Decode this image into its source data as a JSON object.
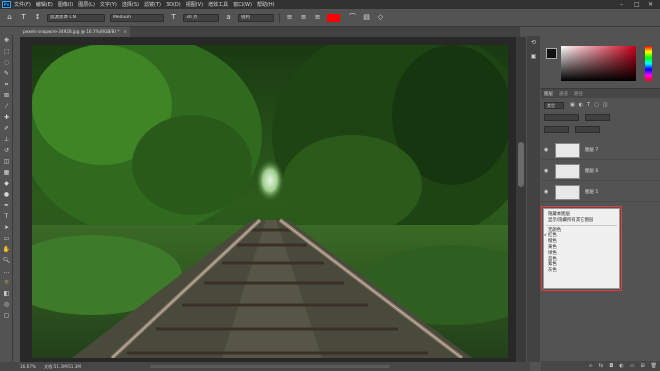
{
  "menubar": {
    "items": [
      "文件(F)",
      "编辑(E)",
      "图像(I)",
      "图层(L)",
      "文字(Y)",
      "选择(S)",
      "滤镜(T)",
      "3D(D)",
      "视图(V)",
      "增效工具",
      "窗口(W)",
      "帮助(H)"
    ],
    "logo": "Ps"
  },
  "options": {
    "font_family": "思源黑体 CN",
    "font_style": "Medium",
    "font_size": "30 点",
    "antialias": "锐利"
  },
  "document": {
    "tab_title": "pexels-snapwire-34928.jpg @ 16.7%(RGB/8) *",
    "zoom": "16.67%",
    "doc_info": "文档:51.3M/51.3M"
  },
  "layers": {
    "tab_label": "图层",
    "tab_channels": "通道",
    "tab_paths": "路径",
    "filter_label": "类型",
    "rows": [
      {
        "name": "图层 7"
      },
      {
        "name": "图层 6"
      },
      {
        "name": "图层 5"
      }
    ]
  },
  "context_menu": {
    "items": [
      "隐藏本图层",
      "显示/隐藏所有其它图层"
    ],
    "colors": [
      "无颜色",
      "红色",
      "橙色",
      "黄色",
      "绿色",
      "蓝色",
      "紫色",
      "灰色"
    ],
    "checked_index": 1
  },
  "colors": {
    "accent": "#ff0000",
    "highlight": "#e63b3b"
  }
}
